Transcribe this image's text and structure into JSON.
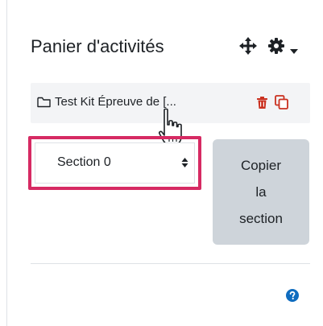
{
  "block": {
    "title": "Panier d'activités",
    "icons": {
      "move": "move-icon",
      "settings": "gear-icon",
      "menu_caret": "caret-down-icon"
    }
  },
  "item": {
    "icon": "folder-icon",
    "label": "Test Kit Épreuve de [...",
    "actions": {
      "delete": "trash-icon",
      "copy": "copy-icon"
    }
  },
  "section_select": {
    "selected": "Section 0",
    "options": [
      "Section 0"
    ]
  },
  "copy_button": {
    "lines": [
      "Copier",
      "la",
      "section"
    ]
  },
  "footer": {
    "icon": "help-icon"
  },
  "colors": {
    "accent_red": "#ca3120",
    "highlight_pink": "#d62a63",
    "help_blue": "#0f6cbf",
    "button_grey": "#ced4da",
    "item_bg": "#f3f4f6"
  }
}
